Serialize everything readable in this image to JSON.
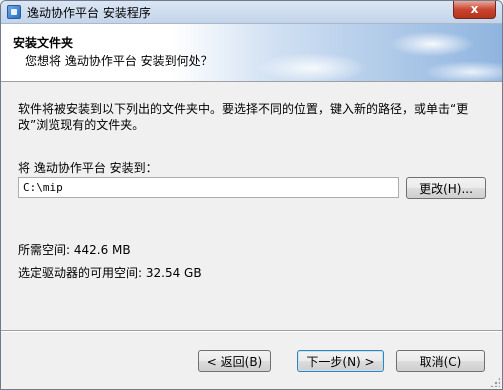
{
  "window": {
    "title": "逸动协作平台 安装程序",
    "close_label": "x"
  },
  "header": {
    "title": "安装文件夹",
    "subtitle": "您想将 逸动协作平台 安装到何处？"
  },
  "body": {
    "description": "软件将被安装到以下列出的文件夹中。要选择不同的位置，键入新的路径，或单击“更改”浏览现有的文件夹。",
    "install_label": "将 逸动协作平台 安装到：",
    "path_value": "C:\\mip",
    "change_button": "更改(H)...",
    "space_required": "所需空间: 442.6 MB",
    "space_available": "选定驱动器的可用空间: 32.54 GB"
  },
  "footer": {
    "back_button": "< 返回(B)",
    "next_button": "下一步(N) >",
    "cancel_button": "取消(C)"
  }
}
